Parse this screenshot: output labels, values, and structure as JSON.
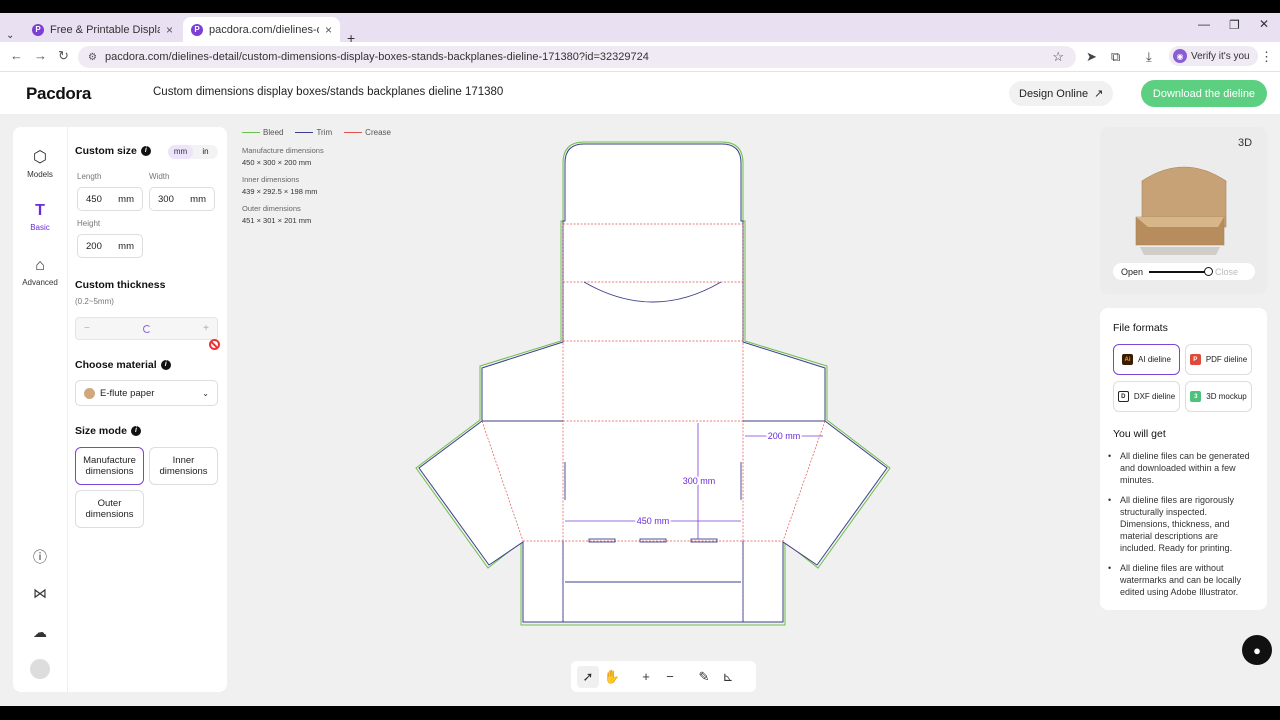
{
  "browser": {
    "tabs": [
      {
        "title": "Free & Printable Display Box"
      },
      {
        "title": "pacdora.com/dielines-detail/"
      }
    ],
    "url": "pacdora.com/dielines-detail/custom-dimensions-display-boxes-stands-backplanes-dieline-171380?id=32329724",
    "profile_label": "Verify it's you"
  },
  "header": {
    "logo": "Pacdora",
    "title": "Custom dimensions display boxes/stands backplanes dieline 171380",
    "design_online": "Design Online",
    "download": "Download the dieline"
  },
  "rail": {
    "models": "Models",
    "basic": "Basic",
    "advanced": "Advanced"
  },
  "custom_size": {
    "title": "Custom size",
    "unit_mm": "mm",
    "unit_in": "in",
    "length_label": "Length",
    "length_value": "450",
    "width_label": "Width",
    "width_value": "300",
    "height_label": "Height",
    "height_value": "200",
    "unit": "mm"
  },
  "thickness": {
    "title": "Custom thickness",
    "range": "(0.2~5mm)",
    "minus": "−",
    "plus": "+"
  },
  "material": {
    "title": "Choose material",
    "value": "E-flute paper"
  },
  "size_mode": {
    "title": "Size mode",
    "manufacture": "Manufacture dimensions",
    "inner": "Inner dimensions",
    "outer": "Outer dimensions"
  },
  "legend": {
    "bleed": "Bleed",
    "trim": "Trim",
    "crease": "Crease",
    "bleed_color": "#6cc04a",
    "trim_color": "#3d3f8a",
    "crease_color": "#e05252"
  },
  "dimensions": {
    "manufacture_label": "Manufacture dimensions",
    "manufacture_value": "450 × 300 × 200 mm",
    "inner_label": "Inner dimensions",
    "inner_value": "439 × 292.5 × 198 mm",
    "outer_label": "Outer dimensions",
    "outer_value": "451 × 301 × 201 mm"
  },
  "dieline_labels": {
    "width": "450 mm",
    "height": "300 mm",
    "depth": "200 mm"
  },
  "preview": {
    "open": "Open",
    "close": "Close",
    "slider_value": 1
  },
  "file_formats": {
    "title": "File formats",
    "ai": "AI dieline",
    "pdf": "PDF dieline",
    "dxf": "DXF dieline",
    "mockup": "3D mockup"
  },
  "you_will_get": {
    "title": "You will get",
    "items": [
      "All dieline files can be generated and downloaded within a few minutes.",
      "All dieline files are rigorously structurally inspected. Dimensions, thickness, and material descriptions are included. Ready for printing.",
      "All dieline files are without watermarks and can be locally edited using Adobe Illustrator."
    ]
  }
}
